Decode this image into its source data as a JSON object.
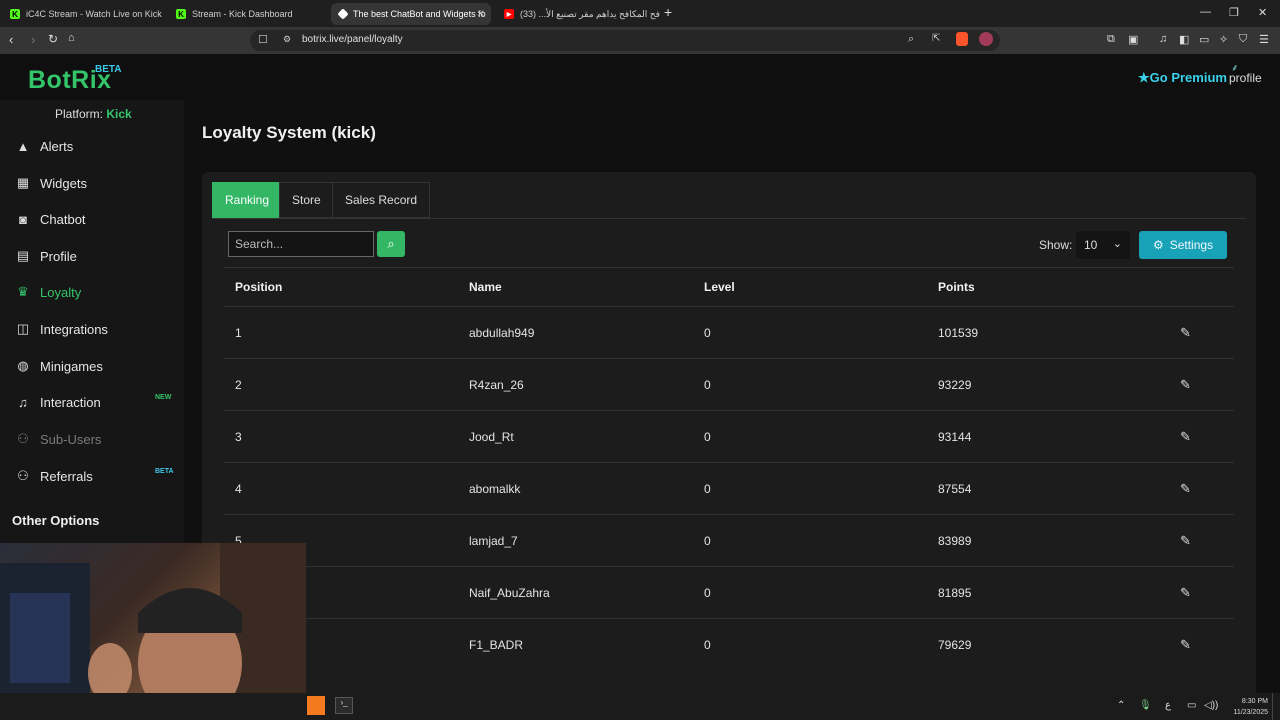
{
  "browser": {
    "tabs": [
      {
        "title": "iC4C Stream - Watch Live on Kick",
        "favicon": "kick-logo"
      },
      {
        "title": "Stream - Kick Dashboard",
        "favicon": "kick-logo"
      },
      {
        "title": "The best ChatBot and Widgets fo",
        "favicon": "botrix-logo",
        "active": true
      },
      {
        "title": "كافح المكافح يداهم مقر تصنيع الأ... (33)",
        "favicon": "youtube-logo"
      }
    ],
    "url": "botrix.live/panel/loyalty",
    "new_tab": "+",
    "window_controls": [
      "—",
      "❐",
      "✕"
    ]
  },
  "header": {
    "logo": "BotRix",
    "logo_badge": "BETA",
    "premium": "Go Premium",
    "profile": "profile"
  },
  "sidebar": {
    "platform_label": "Platform:",
    "platform_value": "Kick",
    "items": [
      {
        "label": "Alerts",
        "icon": "warning-icon"
      },
      {
        "label": "Widgets",
        "icon": "widgets-icon"
      },
      {
        "label": "Chatbot",
        "icon": "robot-icon"
      },
      {
        "label": "Profile",
        "icon": "id-card-icon"
      },
      {
        "label": "Loyalty",
        "icon": "trophy-icon",
        "active": true
      },
      {
        "label": "Integrations",
        "icon": "integrations-icon"
      },
      {
        "label": "Minigames",
        "icon": "gamepad-icon"
      },
      {
        "label": "Interaction",
        "icon": "music-icon",
        "tag": "NEW"
      },
      {
        "label": "Sub-Users",
        "icon": "users-icon",
        "disabled": true
      },
      {
        "label": "Referrals",
        "icon": "users-icon",
        "tag": "BETA"
      }
    ],
    "other_options": "Other Options",
    "colors": {
      "accent": "#34c46a",
      "new_tag": "#34c46a",
      "beta_tag": "#3cc8e8"
    }
  },
  "main": {
    "title": "Loyalty System (kick)",
    "tabs": [
      "Ranking",
      "Store",
      "Sales Record"
    ],
    "search_placeholder": "Search...",
    "show_label": "Show:",
    "show_value": "10",
    "settings_label": "Settings",
    "table": {
      "headers": [
        "Position",
        "Name",
        "Level",
        "Points"
      ],
      "rows": [
        {
          "position": "1",
          "name": "abdullah949",
          "level": "0",
          "points": "101539"
        },
        {
          "position": "2",
          "name": "R4zan_26",
          "level": "0",
          "points": "93229"
        },
        {
          "position": "3",
          "name": "Jood_Rt",
          "level": "0",
          "points": "93144"
        },
        {
          "position": "4",
          "name": "abomalkk",
          "level": "0",
          "points": "87554"
        },
        {
          "position": "5",
          "name": "lamjad_7",
          "level": "0",
          "points": "83989"
        },
        {
          "position": "",
          "name": "Naif_AbuZahra",
          "level": "0",
          "points": "81895"
        },
        {
          "position": "",
          "name": "F1_BADR",
          "level": "0",
          "points": "79629"
        }
      ]
    }
  },
  "taskbar": {
    "tray_lang": "ع",
    "time": "8:30 PM",
    "date": "11/23/2025"
  }
}
